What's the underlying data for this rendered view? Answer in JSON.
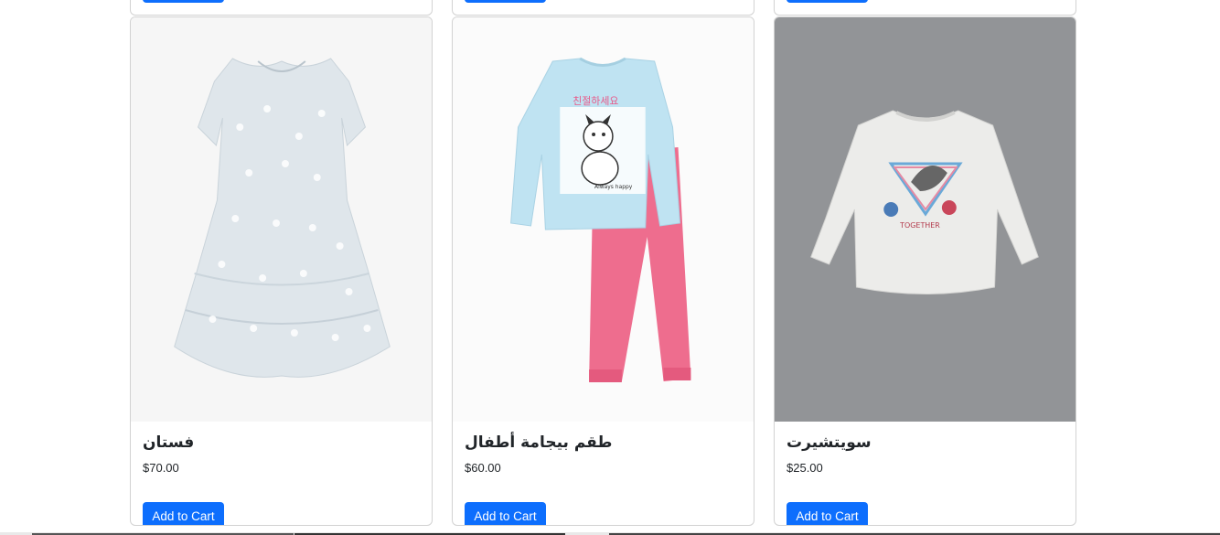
{
  "top_row": {
    "buttons": [
      "add-to-cart-partial",
      "add-to-cart-partial",
      "add-to-cart-partial"
    ]
  },
  "products": [
    {
      "title": "فستان",
      "price": "$70.00",
      "button_label": "Add to Cart",
      "image_icon": "dress-image",
      "image_bg": "#f5f5f5"
    },
    {
      "title": "طقم بيجامة أطفال",
      "price": "$60.00",
      "button_label": "Add to Cart",
      "image_icon": "pajama-set-image",
      "image_bg": "#fafafa"
    },
    {
      "title": "سويتشيرت",
      "price": "$25.00",
      "button_label": "Add to Cart",
      "image_icon": "sweatshirt-image",
      "image_bg": "#929497"
    }
  ],
  "colors": {
    "accent": "#0d6efd",
    "text": "#212529",
    "card_border": "#dcdcdc"
  }
}
